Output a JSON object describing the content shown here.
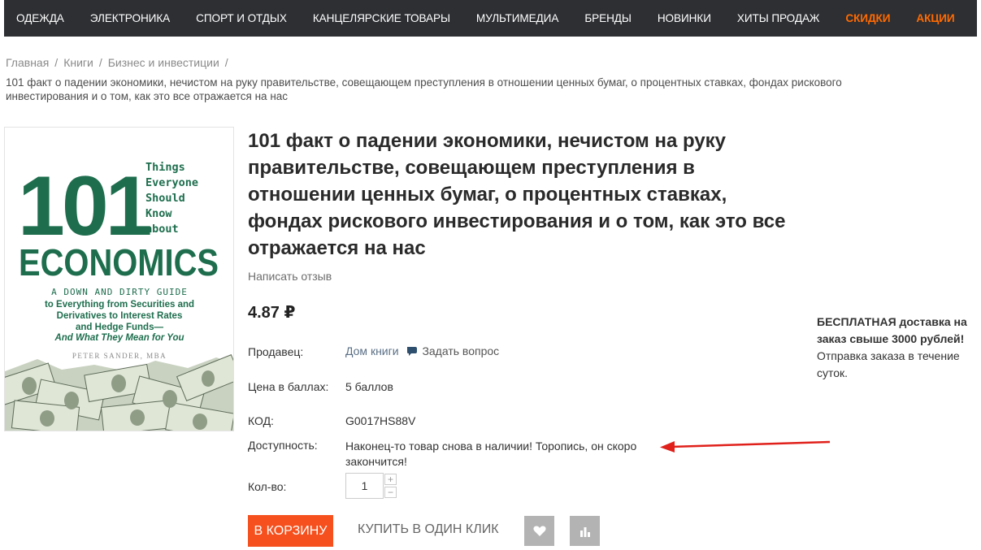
{
  "nav": {
    "items": [
      {
        "label": "ОДЕЖДА",
        "highlight": false
      },
      {
        "label": "ЭЛЕКТРОНИКА",
        "highlight": false
      },
      {
        "label": "СПОРТ И ОТДЫХ",
        "highlight": false
      },
      {
        "label": "КАНЦЕЛЯРСКИЕ ТОВАРЫ",
        "highlight": false
      },
      {
        "label": "МУЛЬТИМЕДИА",
        "highlight": false
      },
      {
        "label": "БРЕНДЫ",
        "highlight": false
      },
      {
        "label": "НОВИНКИ",
        "highlight": false
      },
      {
        "label": "ХИТЫ ПРОДАЖ",
        "highlight": false
      },
      {
        "label": "СКИДКИ",
        "highlight": true
      },
      {
        "label": "АКЦИИ",
        "highlight": true
      }
    ]
  },
  "breadcrumb": {
    "items": [
      "Главная",
      "Книги",
      "Бизнес и инвестиции"
    ],
    "separator": "/",
    "current": "101 факт о падении экономики, нечистом на руку правительстве, совещающем преступления в отношении ценных бумаг, о процентных ставках, фондах рискового инвестирования и о том, как это все отражается на нас"
  },
  "product": {
    "title": "101 факт о падении экономики, нечистом на руку правительстве, совещающем преступления в отношении ценных бумаг, о процентных ставках, фондах рискового инвестирования и о том, как это все отражается на нас",
    "review_link": "Написать отзыв",
    "price": "4.87 ₽",
    "seller_label": "Продавец:",
    "seller_value": "Дом книги",
    "ask_question": "Задать вопрос",
    "points_label": "Цена в баллах:",
    "points_value": "5 баллов",
    "code_label": "КОД:",
    "code_value": "G0017HS88V",
    "availability_label": "Доступность:",
    "availability_value": "Наконец-то товар снова в наличии! Торопись, он скоро закончится!",
    "qty_label": "Кол-во:",
    "qty_value": "1",
    "qty_plus": "+",
    "qty_minus": "−"
  },
  "actions": {
    "add_to_cart": "В КОРЗИНУ",
    "buy_one_click": "КУПИТЬ В ОДИН КЛИК",
    "wishlist_icon": "heart-icon",
    "compare_icon": "bar-chart-icon"
  },
  "delivery": {
    "headline": "БЕСПЛАТНАЯ доставка на заказ свыше 3000 рублей!",
    "note": "Отправка заказа в течение суток."
  },
  "cover": {
    "number": "101",
    "side_text": [
      "Things",
      "Everyone",
      "Should",
      "Know",
      "about"
    ],
    "title": "ECONOMICS",
    "subtitle_1": "A DOWN AND DIRTY GUIDE",
    "subtitle_2": "to Everything from Securities and",
    "subtitle_3": "Derivatives to Interest Rates",
    "subtitle_4": "and Hedge Funds—",
    "subtitle_5": "And What They Mean for You",
    "author": "PETER SANDER, MBA"
  },
  "colors": {
    "nav_bg": "#2d2f33",
    "accent": "#f5501d",
    "cover_green": "#1e6e4e",
    "arrow_red": "#e0201a"
  }
}
